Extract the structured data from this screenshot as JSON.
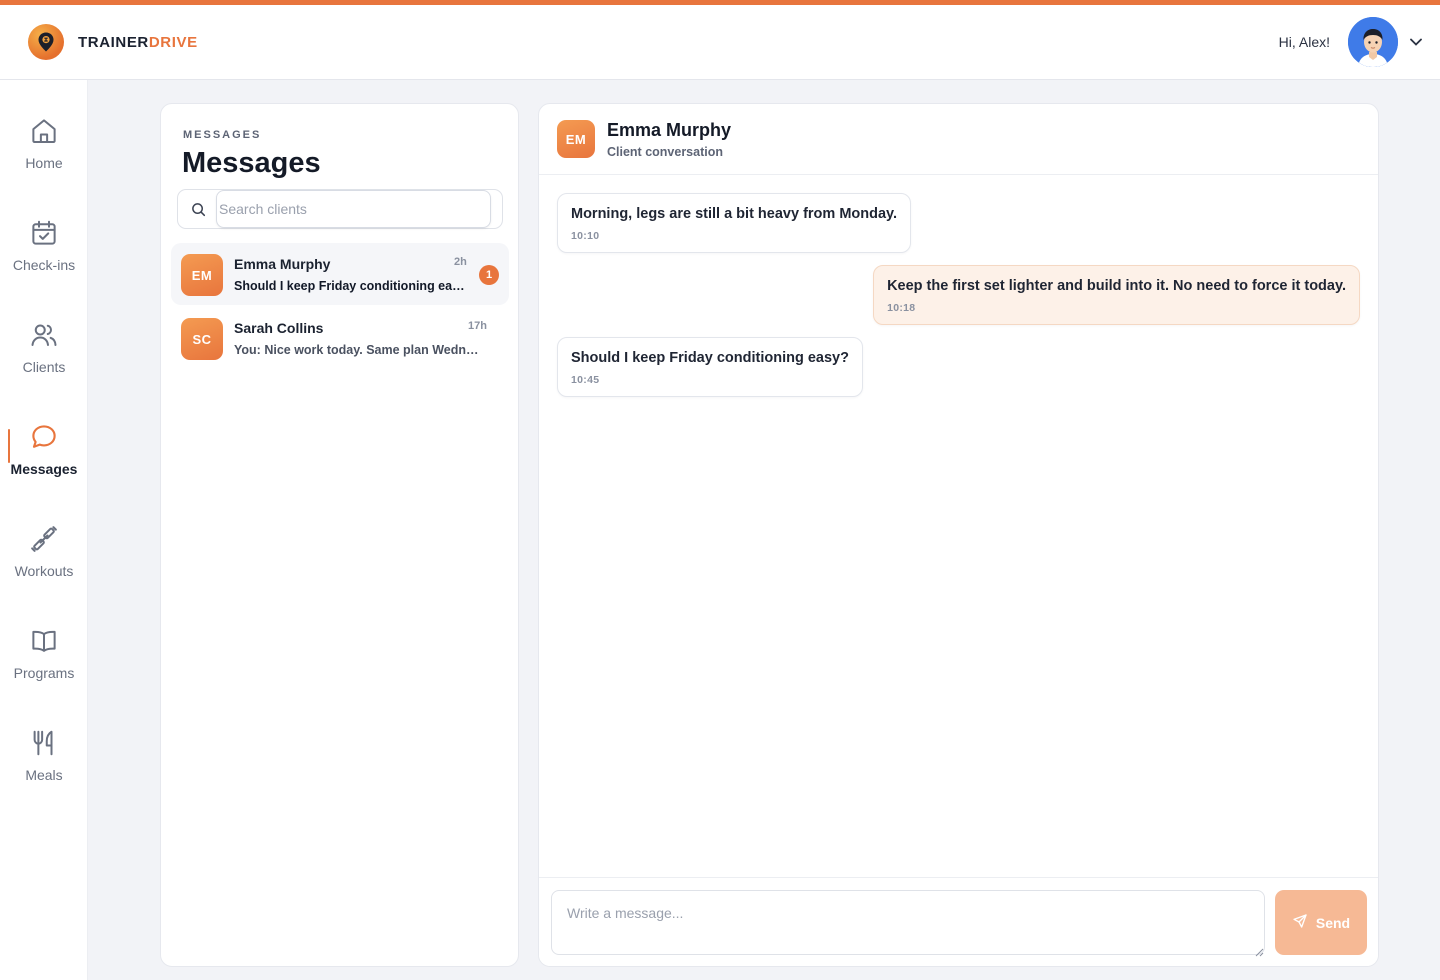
{
  "app": {
    "brand_part1": "TRAINER",
    "brand_part2": "DRIVE",
    "greeting": "Hi, Alex!",
    "accent_color": "#e8753d"
  },
  "sidebar": {
    "items": [
      {
        "label": "Home",
        "icon": "home-icon"
      },
      {
        "label": "Check-ins",
        "icon": "calendar-check-icon"
      },
      {
        "label": "Clients",
        "icon": "users-icon"
      },
      {
        "label": "Messages",
        "icon": "chat-bubble-icon",
        "active": true
      },
      {
        "label": "Workouts",
        "icon": "dumbbell-icon"
      },
      {
        "label": "Programs",
        "icon": "book-icon"
      },
      {
        "label": "Meals",
        "icon": "utensils-icon"
      }
    ]
  },
  "messages_panel": {
    "eyebrow": "MESSAGES",
    "title": "Messages",
    "search_placeholder": "Search clients",
    "conversations": [
      {
        "initials": "EM",
        "name": "Emma Murphy",
        "time": "2h",
        "preview": "Should I keep Friday conditioning easy?",
        "unread": "1"
      },
      {
        "initials": "SC",
        "name": "Sarah Collins",
        "time": "17h",
        "preview": "You: Nice work today. Same plan Wednesday."
      }
    ]
  },
  "chat": {
    "initials": "EM",
    "name": "Emma Murphy",
    "subtitle": "Client conversation",
    "messages": [
      {
        "direction": "incoming",
        "text": "Morning, legs are still a bit heavy from Monday.",
        "time": "10:10"
      },
      {
        "direction": "outgoing",
        "text": "Keep the first set lighter and build into it. No need to force it today.",
        "time": "10:18"
      },
      {
        "direction": "incoming",
        "text": "Should I keep Friday conditioning easy?",
        "time": "10:45"
      }
    ],
    "composer_placeholder": "Write a message...",
    "send_label": "Send"
  }
}
